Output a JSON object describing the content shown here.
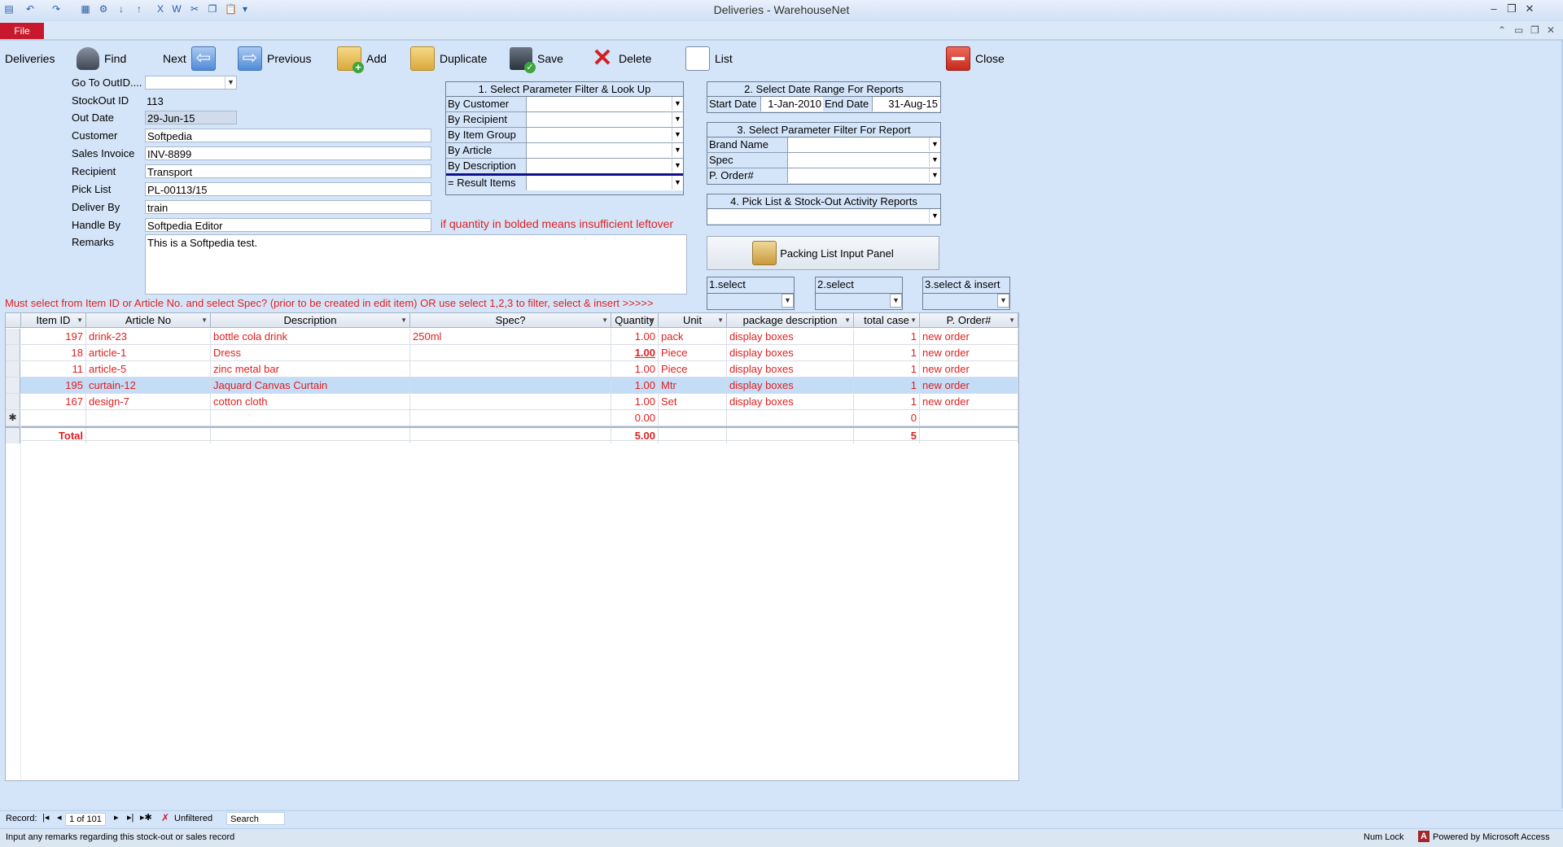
{
  "window": {
    "title": "Deliveries  -  WarehouseNet"
  },
  "ribbon": {
    "file_tab": "File"
  },
  "toolbar": {
    "form_name": "Deliveries",
    "find": "Find",
    "next": "Next",
    "previous": "Previous",
    "add": "Add",
    "duplicate": "Duplicate",
    "save": "Save",
    "delete": "Delete",
    "list": "List",
    "close": "Close"
  },
  "fields": {
    "goto_label": "Go To OutID....",
    "goto_value": "",
    "stockout_label": "StockOut ID",
    "stockout_value": "113",
    "outdate_label": "Out Date",
    "outdate_value": "29-Jun-15",
    "customer_label": "Customer",
    "customer_value": "Softpedia",
    "invoice_label": "Sales Invoice",
    "invoice_value": "INV-8899",
    "recipient_label": "Recipient",
    "recipient_value": "Transport",
    "picklist_label": "Pick List",
    "picklist_value": "PL-00113/15",
    "deliverby_label": "Deliver By",
    "deliverby_value": "train",
    "handleby_label": "Handle By",
    "handleby_value": "Softpedia Editor",
    "remarks_label": "Remarks",
    "remarks_value": "This is a Softpedia test."
  },
  "notes": {
    "bold_note": "if quantity in bolded means insufficient leftover",
    "select_note": "Must select from Item ID  or Article No. and select Spec? (prior to be created in edit item) OR use select 1,2,3 to filter, select & insert >>>>>"
  },
  "panel1": {
    "title": "1. Select Parameter Filter & Look Up",
    "rows": [
      "By Customer",
      "By Recipient",
      "By Item Group",
      "By Article",
      "By Description",
      "= Result Items"
    ]
  },
  "panel2": {
    "title": "2. Select Date Range For  Reports",
    "start_label": "Start Date",
    "start_value": "1-Jan-2010",
    "end_label": "End Date",
    "end_value": "31-Aug-15"
  },
  "panel3": {
    "title": "3. Select Parameter Filter For Report",
    "rows": [
      "Brand Name",
      "Spec",
      "P. Order#"
    ]
  },
  "panel4": {
    "title": "4. Pick List & Stock-Out Activity Reports"
  },
  "packing_button": "Packing List Input Panel",
  "selects": [
    "1.select",
    "2.select",
    "3.select & insert"
  ],
  "grid": {
    "columns": [
      "Item ID",
      "Article No",
      "Description",
      "Spec?",
      "Quantity",
      "Unit",
      "package description",
      "total case",
      "P. Order#"
    ],
    "rows": [
      [
        "197",
        "drink-23",
        "bottle cola drink",
        "250ml",
        "1.00",
        "pack",
        "display boxes",
        "1",
        "new order"
      ],
      [
        "18",
        "article-1",
        "Dress",
        "",
        "1.00",
        "Piece",
        "display boxes",
        "1",
        "new order"
      ],
      [
        "11",
        "article-5",
        "zinc metal bar",
        "",
        "1.00",
        "Piece",
        "display boxes",
        "1",
        "new order"
      ],
      [
        "195",
        "curtain-12",
        "Jaquard Canvas Curtain",
        "",
        "1.00",
        "Mtr",
        "display boxes",
        "1",
        "new order"
      ],
      [
        "167",
        "design-7",
        "cotton cloth",
        "",
        "1.00",
        "Set",
        "display boxes",
        "1",
        "new order"
      ]
    ],
    "new_row": {
      "marker": "✱",
      "quantity": "0.00",
      "total_case": "0"
    },
    "total_row": {
      "label": "Total",
      "quantity": "5.00",
      "total_case": "5"
    }
  },
  "recnav": {
    "label": "Record:",
    "position": "1 of 101",
    "filter": "Unfiltered",
    "search": "Search"
  },
  "status": {
    "hint": "Input any remarks regarding this stock-out or sales record",
    "numlock": "Num Lock",
    "powered": "Powered by Microsoft Access"
  }
}
